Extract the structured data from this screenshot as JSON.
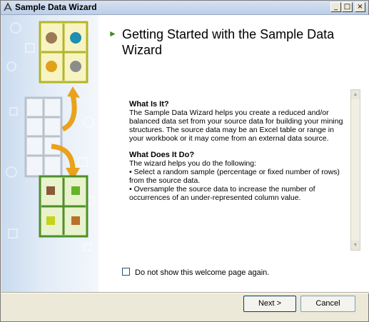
{
  "window": {
    "title": "Sample Data Wizard",
    "controls": {
      "minimize": "_",
      "maximize": "□",
      "close": "×"
    }
  },
  "page": {
    "heading": "Getting Started with the Sample Data Wizard",
    "sections": [
      {
        "title": "What Is It?",
        "paragraphs": [
          "The Sample Data Wizard helps you create a reduced and/or balanced data set from your source data for building your mining structures. The source data may be an Excel table or range in your workbook or it may come from an external data source."
        ]
      },
      {
        "title": "What Does It Do?",
        "paragraphs": [
          "The wizard helps you do the following:",
          "• Select a random sample (percentage or fixed number of rows) from the source data.",
          "• Oversample the source data to increase the number of occurrences of an under-represented column value."
        ]
      }
    ]
  },
  "checkbox": {
    "label": "Do not show this welcome page again.",
    "checked": false
  },
  "buttons": {
    "next": "Next >",
    "cancel": "Cancel"
  },
  "colors": {
    "accent_green": "#3a8a1e",
    "arrow_orange": "#e9a21c"
  },
  "icons": {
    "app": "wizard-icon",
    "heading": "triangle-bullet-icon",
    "illustration": "data-grid-illustration"
  }
}
